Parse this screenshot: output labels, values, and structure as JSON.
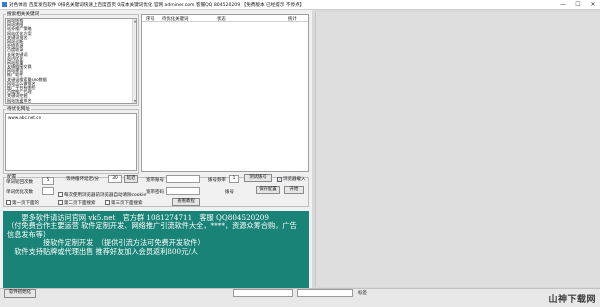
{
  "window": {
    "title": "对色体验 百度发包软件 0排名关键词快速上百度首页 0成本关键词优化 官网 adminer.com 客服QQ 804520209 【免费版本 已经提示 不停点】",
    "minimize": "—",
    "maximize": "☐",
    "close": "✕"
  },
  "keywords_group": {
    "title": "搜索相关关键词",
    "items": [
      "网站结构",
      "网站地图",
      "站外推广策略",
      "网站优化方案",
      "关键词排名",
      "网站诊断",
      "外链资源",
      "百度收录",
      "长尾关键词",
      "站内优化",
      "网站权重",
      "友情链接交换",
      "网站建设",
      "推广软件",
      "关键词搜索量seo数据",
      "网站怎么做排名",
      "推广平台有哪些",
      "百度推广代理",
      "关键词挖掘",
      "网站快速排名",
      "网站运营",
      "百度优化",
      "整站优化",
      "页面优化"
    ]
  },
  "target_url": {
    "title": "待优化网址",
    "value": "www.abc.net.cn"
  },
  "results_grid": {
    "col_index": "序号",
    "col_keyword": "待优化关键词",
    "col_status": "状态",
    "col_stats": "统计"
  },
  "settings": {
    "title": "配置",
    "single_rounds_label": "单词轮回次数",
    "single_rounds_value": "5",
    "wait_label": "等待循环延迟/分",
    "wait_value": "30",
    "wait_unit": "延迟",
    "single_opt_label": "单词优化次数",
    "single_opt_value": "",
    "baidu_account_label": "宽带账号",
    "baidu_account_value": "",
    "dial_freq_label": "拨号频率",
    "dial_freq_value": "1",
    "test_dial_button": "测试拨号",
    "browser_check_label": "浏览器载入",
    "browser_check_mark": "✓",
    "save_button": "保存配置",
    "start_button": "开始",
    "cookie_check_label": "每次使用浏览器前浏览器自动清除cookie",
    "password_label": "宽带密码",
    "dial_label": "拨号",
    "page1_label": "第一页下面的",
    "page2_label": "第二页下面搜索",
    "page3_label": "第三页下面搜索",
    "tutorial_button": "查看教程"
  },
  "info_panel": {
    "lines": [
      "　　更多软件请访问官网 vk5.net　官方群 1081274711　客服 QQ804520209",
      "（付免费合作主要运营 软件定制开发、网络推广引流软件大全，****，资源众筹合购，广告",
      "信息发布等）",
      "　　　　　接软件定制开发　（提供引流方法可免费开发软件）",
      "　软件支持贴牌或代理出售 推荐好友加入会员返利800元/人"
    ]
  },
  "statusbar": {
    "init_button": "软件初始化",
    "field_label": "标签",
    "watermark": "山神下载网"
  },
  "colors": {
    "info_bg": "#1a8378",
    "panel_bg": "#f0f0f0"
  }
}
